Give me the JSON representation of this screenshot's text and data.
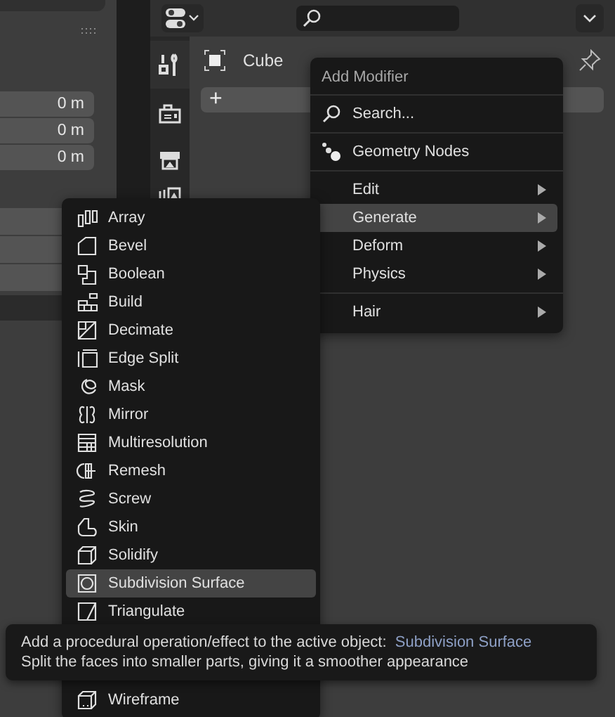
{
  "left_panel": {
    "fields": [
      {
        "value": "0 m"
      },
      {
        "value": "0 m"
      },
      {
        "value": "0 m"
      }
    ]
  },
  "properties": {
    "object_name": "Cube",
    "add_button": "+"
  },
  "add_menu": {
    "title": "Add Modifier",
    "sections": [
      [
        {
          "kind": "search",
          "label": "Search...",
          "selected": false
        }
      ],
      [
        {
          "kind": "nodes",
          "label": "Geometry Nodes",
          "selected": false
        }
      ],
      [
        {
          "kind": "submenu",
          "label": "Edit",
          "selected": false
        },
        {
          "kind": "submenu",
          "label": "Generate",
          "selected": true
        },
        {
          "kind": "submenu",
          "label": "Deform",
          "selected": false
        },
        {
          "kind": "submenu",
          "label": "Physics",
          "selected": false
        }
      ],
      [
        {
          "kind": "submenu",
          "label": "Hair",
          "selected": false
        }
      ]
    ]
  },
  "generate_menu": {
    "items": [
      {
        "label": "Array",
        "selected": false
      },
      {
        "label": "Bevel",
        "selected": false
      },
      {
        "label": "Boolean",
        "selected": false
      },
      {
        "label": "Build",
        "selected": false
      },
      {
        "label": "Decimate",
        "selected": false
      },
      {
        "label": "Edge Split",
        "selected": false
      },
      {
        "label": "Mask",
        "selected": false
      },
      {
        "label": "Mirror",
        "selected": false
      },
      {
        "label": "Multiresolution",
        "selected": false
      },
      {
        "label": "Remesh",
        "selected": false
      },
      {
        "label": "Screw",
        "selected": false
      },
      {
        "label": "Skin",
        "selected": false
      },
      {
        "label": "Solidify",
        "selected": false
      },
      {
        "label": "Subdivision Surface",
        "selected": true
      },
      {
        "label": "Triangulate",
        "selected": false
      },
      {
        "label": "Wireframe",
        "selected": false
      }
    ]
  },
  "tooltip": {
    "description": "Add a procedural operation/effect to the active object:",
    "operator": "Subdivision Surface",
    "detail": "Split the faces into smaller parts, giving it a smoother appearance"
  }
}
